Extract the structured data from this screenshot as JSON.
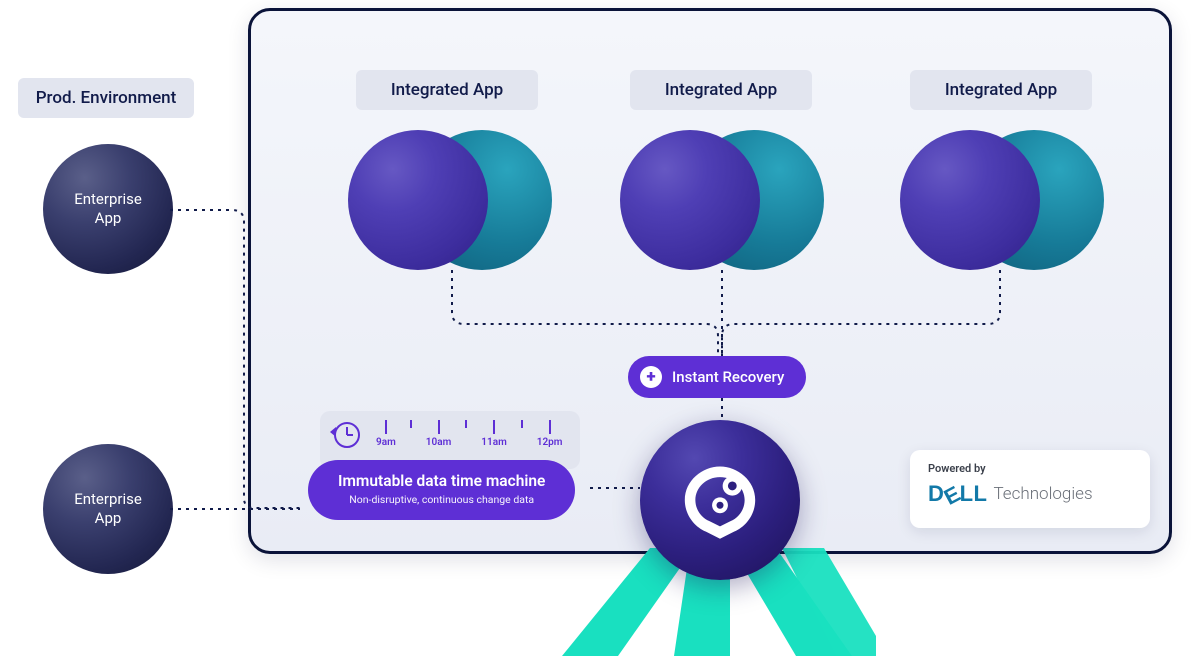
{
  "prod_label": "Prod. Environment",
  "enterprise_apps": [
    "Enterprise\nApp",
    "Enterprise\nApp"
  ],
  "integrated_apps": [
    "Integrated App",
    "Integrated App",
    "Integrated App"
  ],
  "recovery": {
    "label": "Instant Recovery"
  },
  "timeline": {
    "times": [
      "9am",
      "10am",
      "11am",
      "12pm"
    ]
  },
  "time_machine": {
    "title": "Immutable data time machine",
    "subtitle": "Non-disruptive, continuous change data"
  },
  "powered_by": {
    "label": "Powered by",
    "brand": "DELL",
    "brand_suffix": "Technologies"
  }
}
